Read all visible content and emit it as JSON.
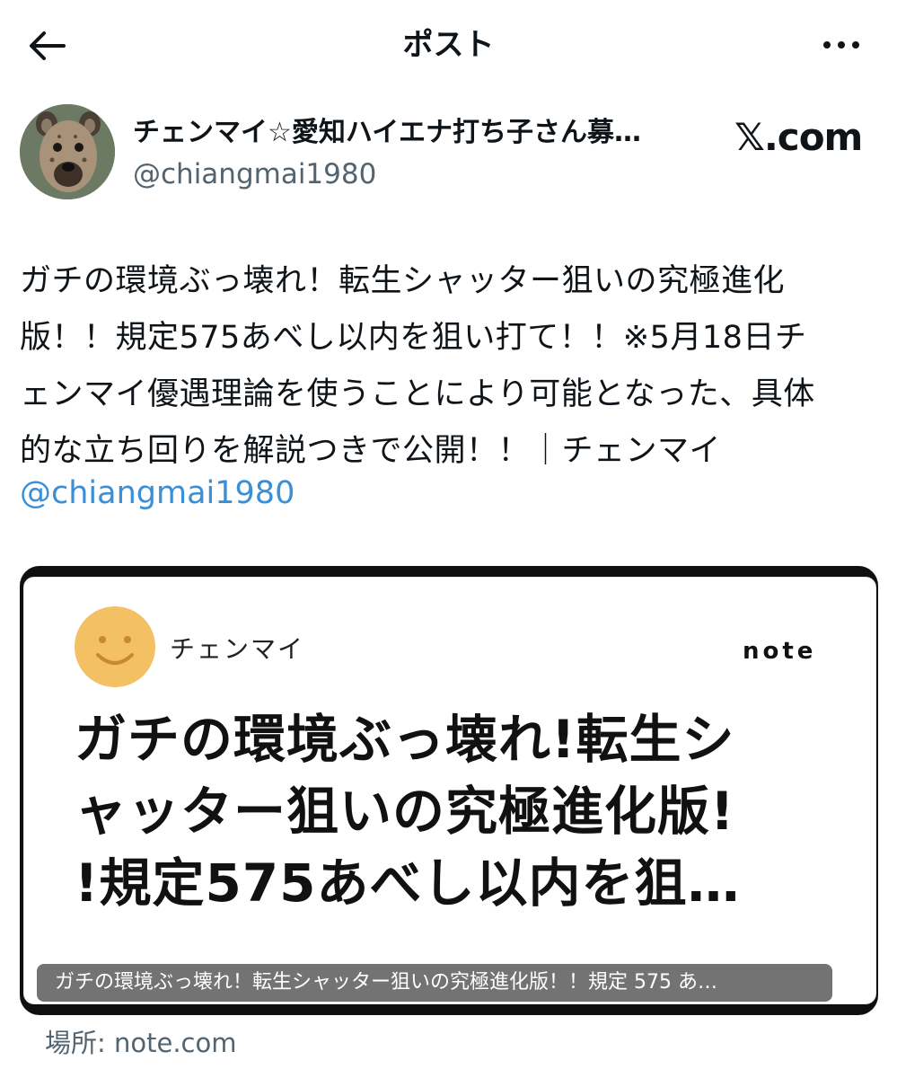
{
  "header": {
    "title": "ポスト",
    "back_icon": "arrow-left-icon",
    "more_icon": "ellipsis-icon"
  },
  "author": {
    "display_name": "チェンマイ☆愛知ハイエナ打ち子さん募…",
    "handle": "@chiangmai1980",
    "avatar_icon": "hyena-avatar",
    "brand_logo": "𝕏.com"
  },
  "tweet": {
    "lines": [
      "ガチの環境ぶっ壊れ！転生シャッター狙いの究極進化",
      "版！！規定575あべし以内を狙い打て！！※5月18日チ",
      "ェンマイ優遇理論を使うことにより可能となった、具体",
      "的な立ち回りを解説つきで公開！！｜チェンマイ"
    ],
    "mention": "@chiangmai1980"
  },
  "card": {
    "author": "チェンマイ",
    "site_logo": "note",
    "headline_lines": [
      "ガチの環境ぶっ壊れ!転生シ",
      "ャッター狙いの究極進化版!",
      "!規定575あべし以内を狙…"
    ],
    "caption": "ガチの環境ぶっ壊れ！転生シャッター狙いの究極進化版！！規定 575 あ…",
    "source": "場所: note.com"
  },
  "colors": {
    "link": "#3b8fd6",
    "secondary_text": "#536471",
    "smiley": "#f3c063"
  }
}
